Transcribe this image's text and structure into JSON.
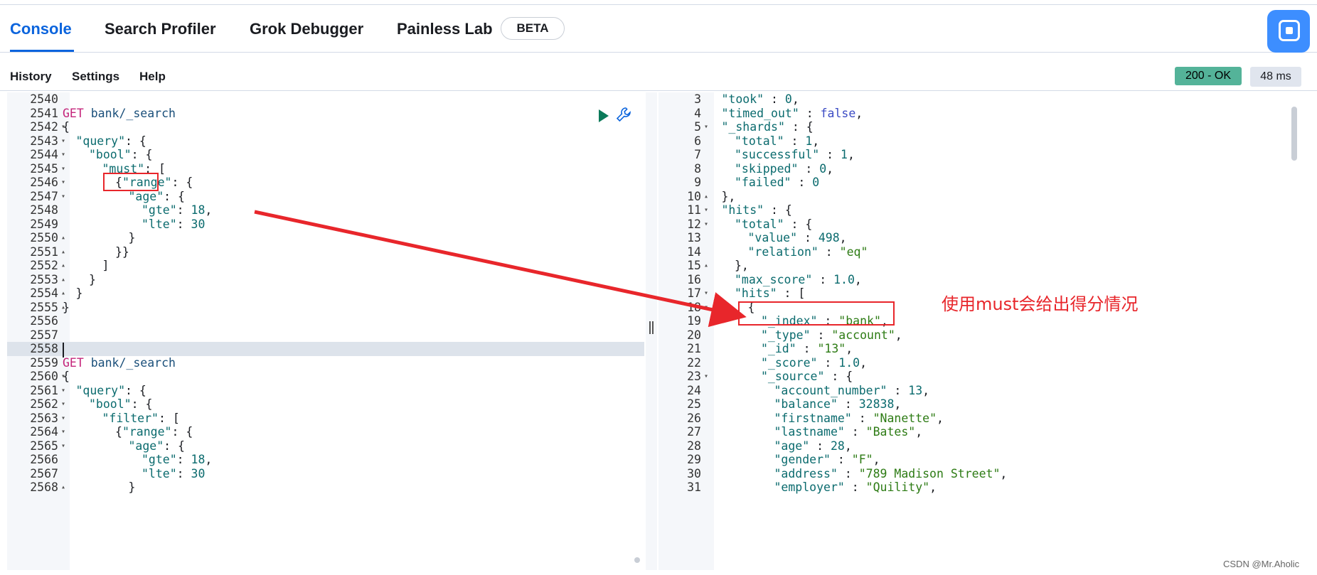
{
  "tabs": [
    {
      "label": "Console",
      "active": true
    },
    {
      "label": "Search Profiler"
    },
    {
      "label": "Grok Debugger"
    },
    {
      "label": "Painless Lab"
    }
  ],
  "beta_badge": "BETA",
  "app_icon": "assistant-icon",
  "toolbar": {
    "history": "History",
    "settings": "Settings",
    "help": "Help",
    "status": "200 - OK",
    "time": "48 ms",
    "status_color": "#54b399"
  },
  "request_lines": [
    {
      "n": "2540",
      "fold": "",
      "indent": 0,
      "text": ""
    },
    {
      "n": "2541",
      "fold": "",
      "indent": 0,
      "method": "GET",
      "url": " bank/_search"
    },
    {
      "n": "2542",
      "fold": "▾",
      "indent": 0,
      "text": "{"
    },
    {
      "n": "2543",
      "fold": "▾",
      "indent": 1,
      "key": "\"query\"",
      "rest": ": {"
    },
    {
      "n": "2544",
      "fold": "▾",
      "indent": 2,
      "key": "\"bool\"",
      "rest": ": {"
    },
    {
      "n": "2545",
      "fold": "▾",
      "indent": 3,
      "key": "\"must\"",
      "rest": ": ["
    },
    {
      "n": "2546",
      "fold": "▾",
      "indent": 4,
      "pre": "{",
      "key": "\"range\"",
      "rest": ": {"
    },
    {
      "n": "2547",
      "fold": "▾",
      "indent": 5,
      "key": "\"age\"",
      "rest": ": {"
    },
    {
      "n": "2548",
      "fold": "",
      "indent": 6,
      "key": "\"gte\"",
      "rest": ": ",
      "num": "18",
      "post": ","
    },
    {
      "n": "2549",
      "fold": "",
      "indent": 6,
      "key": "\"lte\"",
      "rest": ": ",
      "num": "30"
    },
    {
      "n": "2550",
      "fold": "▴",
      "indent": 5,
      "text": "}"
    },
    {
      "n": "2551",
      "fold": "▴",
      "indent": 4,
      "text": "}}"
    },
    {
      "n": "2552",
      "fold": "▴",
      "indent": 3,
      "text": "]"
    },
    {
      "n": "2553",
      "fold": "▴",
      "indent": 2,
      "text": "}"
    },
    {
      "n": "2554",
      "fold": "▴",
      "indent": 1,
      "text": "}"
    },
    {
      "n": "2555",
      "fold": "▴",
      "indent": 0,
      "text": "}"
    },
    {
      "n": "2556",
      "fold": "",
      "indent": 0,
      "text": ""
    },
    {
      "n": "2557",
      "fold": "",
      "indent": 0,
      "text": ""
    },
    {
      "n": "2558",
      "fold": "",
      "indent": 0,
      "text": "",
      "active": true
    },
    {
      "n": "2559",
      "fold": "",
      "indent": 0,
      "method": "GET",
      "url": " bank/_search"
    },
    {
      "n": "2560",
      "fold": "▾",
      "indent": 0,
      "text": "{"
    },
    {
      "n": "2561",
      "fold": "▾",
      "indent": 1,
      "key": "\"query\"",
      "rest": ": {"
    },
    {
      "n": "2562",
      "fold": "▾",
      "indent": 2,
      "key": "\"bool\"",
      "rest": ": {"
    },
    {
      "n": "2563",
      "fold": "▾",
      "indent": 3,
      "key": "\"filter\"",
      "rest": ": ["
    },
    {
      "n": "2564",
      "fold": "▾",
      "indent": 4,
      "pre": "{",
      "key": "\"range\"",
      "rest": ": {"
    },
    {
      "n": "2565",
      "fold": "▾",
      "indent": 5,
      "key": "\"age\"",
      "rest": ": {"
    },
    {
      "n": "2566",
      "fold": "",
      "indent": 6,
      "key": "\"gte\"",
      "rest": ": ",
      "num": "18",
      "post": ","
    },
    {
      "n": "2567",
      "fold": "",
      "indent": 6,
      "key": "\"lte\"",
      "rest": ": ",
      "num": "30"
    },
    {
      "n": "2568",
      "fold": "▴",
      "indent": 5,
      "text": "}"
    }
  ],
  "response_lines": [
    {
      "n": "3",
      "fold": "",
      "indent": 1,
      "key": "\"took\"",
      "rest": " : ",
      "num": "0",
      "post": ","
    },
    {
      "n": "4",
      "fold": "",
      "indent": 1,
      "key": "\"timed_out\"",
      "rest": " : ",
      "bool": "false",
      "post": ","
    },
    {
      "n": "5",
      "fold": "▾",
      "indent": 1,
      "key": "\"_shards\"",
      "rest": " : {"
    },
    {
      "n": "6",
      "fold": "",
      "indent": 2,
      "key": "\"total\"",
      "rest": " : ",
      "num": "1",
      "post": ","
    },
    {
      "n": "7",
      "fold": "",
      "indent": 2,
      "key": "\"successful\"",
      "rest": " : ",
      "num": "1",
      "post": ","
    },
    {
      "n": "8",
      "fold": "",
      "indent": 2,
      "key": "\"skipped\"",
      "rest": " : ",
      "num": "0",
      "post": ","
    },
    {
      "n": "9",
      "fold": "",
      "indent": 2,
      "key": "\"failed\"",
      "rest": " : ",
      "num": "0"
    },
    {
      "n": "10",
      "fold": "▴",
      "indent": 1,
      "text": "},"
    },
    {
      "n": "11",
      "fold": "▾",
      "indent": 1,
      "key": "\"hits\"",
      "rest": " : {"
    },
    {
      "n": "12",
      "fold": "▾",
      "indent": 2,
      "key": "\"total\"",
      "rest": " : {"
    },
    {
      "n": "13",
      "fold": "",
      "indent": 3,
      "key": "\"value\"",
      "rest": " : ",
      "num": "498",
      "post": ","
    },
    {
      "n": "14",
      "fold": "",
      "indent": 3,
      "key": "\"relation\"",
      "rest": " : ",
      "str": "\"eq\""
    },
    {
      "n": "15",
      "fold": "▴",
      "indent": 2,
      "text": "},"
    },
    {
      "n": "16",
      "fold": "",
      "indent": 2,
      "key": "\"max_score\"",
      "rest": " : ",
      "num": "1.0",
      "post": ","
    },
    {
      "n": "17",
      "fold": "▾",
      "indent": 2,
      "key": "\"hits\"",
      "rest": " : ["
    },
    {
      "n": "18",
      "fold": "▾",
      "indent": 3,
      "text": "{"
    },
    {
      "n": "19",
      "fold": "",
      "indent": 4,
      "key": "\"_index\"",
      "rest": " : ",
      "str": "\"bank\"",
      "post": ","
    },
    {
      "n": "20",
      "fold": "",
      "indent": 4,
      "key": "\"_type\"",
      "rest": " : ",
      "str": "\"account\"",
      "post": ","
    },
    {
      "n": "21",
      "fold": "",
      "indent": 4,
      "key": "\"_id\"",
      "rest": " : ",
      "str": "\"13\"",
      "post": ","
    },
    {
      "n": "22",
      "fold": "",
      "indent": 4,
      "key": "\"_score\"",
      "rest": " : ",
      "num": "1.0",
      "post": ","
    },
    {
      "n": "23",
      "fold": "▾",
      "indent": 4,
      "key": "\"_source\"",
      "rest": " : {"
    },
    {
      "n": "24",
      "fold": "",
      "indent": 5,
      "key": "\"account_number\"",
      "rest": " : ",
      "num": "13",
      "post": ","
    },
    {
      "n": "25",
      "fold": "",
      "indent": 5,
      "key": "\"balance\"",
      "rest": " : ",
      "num": "32838",
      "post": ","
    },
    {
      "n": "26",
      "fold": "",
      "indent": 5,
      "key": "\"firstname\"",
      "rest": " : ",
      "str": "\"Nanette\"",
      "post": ","
    },
    {
      "n": "27",
      "fold": "",
      "indent": 5,
      "key": "\"lastname\"",
      "rest": " : ",
      "str": "\"Bates\"",
      "post": ","
    },
    {
      "n": "28",
      "fold": "",
      "indent": 5,
      "key": "\"age\"",
      "rest": " : ",
      "num": "28",
      "post": ","
    },
    {
      "n": "29",
      "fold": "",
      "indent": 5,
      "key": "\"gender\"",
      "rest": " : ",
      "str": "\"F\"",
      "post": ","
    },
    {
      "n": "30",
      "fold": "",
      "indent": 5,
      "key": "\"address\"",
      "rest": " : ",
      "str": "\"789 Madison Street\"",
      "post": ","
    },
    {
      "n": "31",
      "fold": "",
      "indent": 5,
      "key": "\"employer\"",
      "rest": " : ",
      "str": "\"Quility\"",
      "post": ","
    }
  ],
  "annotation": "使用must会给出得分情况",
  "annotation_color": "#e8262b",
  "watermark": "CSDN @Mr.Aholic"
}
